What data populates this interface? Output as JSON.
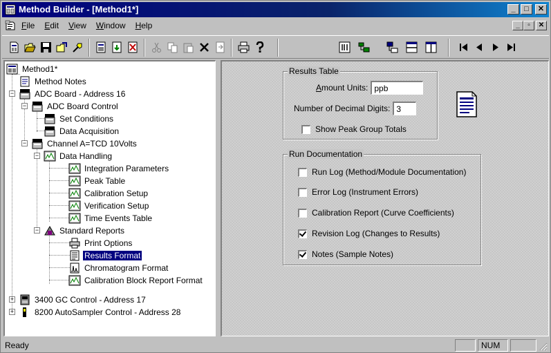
{
  "window": {
    "title": "Method Builder - [Method1*]"
  },
  "menu": [
    "File",
    "Edit",
    "View",
    "Window",
    "Help"
  ],
  "toolbar": {
    "buttons": [
      "new",
      "open",
      "save",
      "open-folder",
      "tool",
      "method-a",
      "method-b",
      "method-c",
      "cut",
      "copy",
      "paste",
      "delete",
      "insert",
      "print",
      "help",
      "columns",
      "add-tree",
      "tree-view",
      "horizontal-split",
      "vertical-split",
      "first",
      "previous",
      "next",
      "last"
    ]
  },
  "tree": {
    "root": "Method1*",
    "method_notes": "Method Notes",
    "adc_board": "ADC Board - Address 16",
    "adc_control": "ADC Board Control",
    "set_conditions": "Set Conditions",
    "data_acquisition": "Data Acquisition",
    "channel": "Channel A=TCD 10Volts",
    "data_handling": "Data Handling",
    "integration_parameters": "Integration Parameters",
    "peak_table": "Peak Table",
    "calibration_setup": "Calibration Setup",
    "verification_setup": "Verification Setup",
    "time_events": "Time Events Table",
    "standard_reports": "Standard Reports",
    "print_options": "Print Options",
    "results_format": "Results Format",
    "chromatogram_format": "Chromatogram Format",
    "calibration_block": "Calibration Block Report Format",
    "gc_control": "3400 GC Control - Address 17",
    "autosampler": "8200 AutoSampler Control - Address 28"
  },
  "results_table": {
    "legend": "Results Table",
    "amount_units_label": "Amount Units:",
    "amount_units_value": "ppb",
    "decimal_digits_label": "Number of Decimal Digits:",
    "decimal_digits_value": "3",
    "show_peak_group_totals": {
      "label": "Show Peak Group Totals",
      "checked": false
    }
  },
  "run_documentation": {
    "legend": "Run Documentation",
    "items": [
      {
        "label": "Run Log (Method/Module Documentation)",
        "checked": false
      },
      {
        "label": "Error Log (Instrument Errors)",
        "checked": false
      },
      {
        "label": "Calibration Report (Curve Coefficients)",
        "checked": false
      },
      {
        "label": "Revision Log (Changes to Results)",
        "checked": true
      },
      {
        "label": "Notes (Sample Notes)",
        "checked": true
      }
    ]
  },
  "status": {
    "text": "Ready",
    "num": "NUM"
  }
}
